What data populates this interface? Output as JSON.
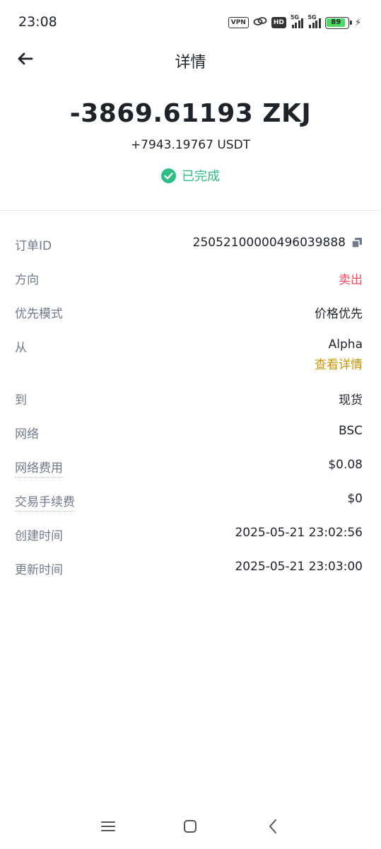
{
  "status_bar": {
    "time": "23:08",
    "vpn": "VPN",
    "hd": "HD",
    "sig1_label": "5G",
    "sig2_label": "5G",
    "battery": "89"
  },
  "header": {
    "title": "详情"
  },
  "summary": {
    "amount": "-3869.61193 ZKJ",
    "received": "+7943.19767 USDT",
    "status": "已完成",
    "status_color": "#2ebd85"
  },
  "details": {
    "order_id_label": "订单ID",
    "order_id_value": "25052100000496039888",
    "direction_label": "方向",
    "direction_value": "卖出",
    "priority_label": "优先模式",
    "priority_value": "价格优先",
    "from_label": "从",
    "from_value": "Alpha",
    "from_link": "查看详情",
    "to_label": "到",
    "to_value": "现货",
    "network_label": "网络",
    "network_value": "BSC",
    "network_fee_label": "网络费用",
    "network_fee_value": "$0.08",
    "trade_fee_label": "交易手续费",
    "trade_fee_value": "$0",
    "created_label": "创建时间",
    "created_value": "2025-05-21 23:02:56",
    "updated_label": "更新时间",
    "updated_value": "2025-05-21 23:03:00"
  },
  "colors": {
    "sell": "#f6465d",
    "link": "#c99400",
    "label": "#707a8a"
  }
}
